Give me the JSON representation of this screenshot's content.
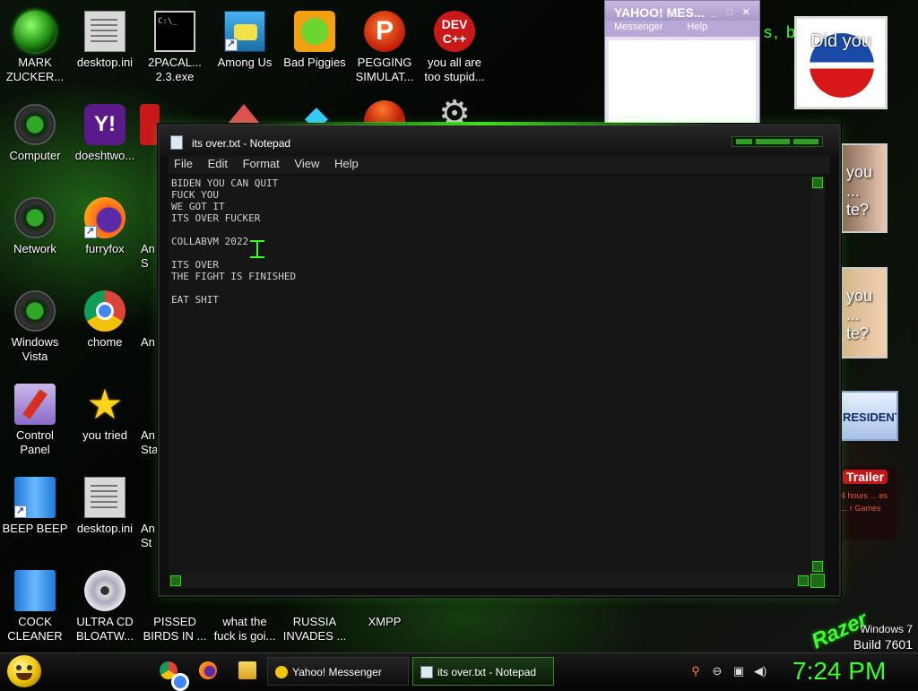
{
  "desktop": {
    "icons": [
      {
        "label": "MARK ZUCKER...",
        "kind": "orb"
      },
      {
        "label": "desktop.ini",
        "kind": "doc"
      },
      {
        "label": "2PACAL... 2.3.exe",
        "kind": "cmd"
      },
      {
        "label": "Among Us",
        "kind": "amongus"
      },
      {
        "label": "Bad Piggies",
        "kind": "piggies"
      },
      {
        "label": "PEGGING SIMULAT...",
        "kind": "p"
      },
      {
        "label": "you all are too stupid...",
        "kind": "dev"
      },
      {
        "label": "Computer",
        "kind": "orb-dark"
      },
      {
        "label": "doeshtwo...",
        "kind": "yahoo"
      },
      {
        "label": "Network",
        "kind": "orb-dark"
      },
      {
        "label": "furryfox",
        "kind": "fox"
      },
      {
        "label": "Windows Vista",
        "kind": "orb-dark"
      },
      {
        "label": "chome",
        "kind": "chrome"
      },
      {
        "label": "Control Panel",
        "kind": "panel"
      },
      {
        "label": "you tried",
        "kind": "star"
      },
      {
        "label": "BEEP BEEP",
        "kind": "blue"
      },
      {
        "label": "desktop.ini",
        "kind": "doc"
      },
      {
        "label": "COCK CLEANER",
        "kind": "blue"
      },
      {
        "label": "ULTRA CD BLOATW...",
        "kind": "cd"
      },
      {
        "label": "PISSED BIRDS IN ...",
        "kind": "birds"
      },
      {
        "label": "what the fuck is goi...",
        "kind": "blue"
      },
      {
        "label": "RUSSIA INVADES ...",
        "kind": "birds"
      },
      {
        "label": "XMPP",
        "kind": "xmpp"
      }
    ],
    "partial_icon_labels": [
      "An",
      "An S",
      "An",
      "An Sta",
      "An St"
    ],
    "icon_glyph_text": {
      "cmd": "C:\\_",
      "p": "P",
      "dev": "DEV C++",
      "yahoo": "Y!",
      "star": "★"
    },
    "top_right_text": "s, b...",
    "razer_logo": "Razer",
    "windows_edition": "Windows 7",
    "windows_build": "Build 7601"
  },
  "yahoo_window": {
    "title": "YAHOO! MES...",
    "controls": "_ □ ✕",
    "menu": [
      "Messenger",
      "Help"
    ]
  },
  "ads": {
    "obama_text": "Did you",
    "face1_text": "you ... te?",
    "face2_text": "you ... te?",
    "president_text": "RESIDENT",
    "trailer_title": "Trailer",
    "trailer_sub": "4 hours ... es ... r Games"
  },
  "notepad": {
    "title": "its over.txt - Notepad",
    "menu": [
      "File",
      "Edit",
      "Format",
      "View",
      "Help"
    ],
    "content": "BIDEN YOU CAN QUIT\nFUCK YOU\nWE GOT IT\nITS OVER FUCKER\n\nCOLLABVM 2022\n\nITS OVER\nTHE FIGHT IS FINISHED\n\nEAT SHIT"
  },
  "taskbar": {
    "pinned": [
      "chrome",
      "firefox",
      "explorer"
    ],
    "tasks": [
      {
        "label": "Yahoo! Messenger",
        "active": false
      },
      {
        "label": "its over.txt - Notepad",
        "active": true
      }
    ],
    "tray_icons": [
      "search-icon",
      "minus-icon",
      "network-icon",
      "speaker-icon"
    ],
    "clock": "7:24 PM"
  },
  "colors": {
    "accent": "#3aff2a",
    "taskbar": "#0f0f0f",
    "notepad_bg": "#161616"
  }
}
